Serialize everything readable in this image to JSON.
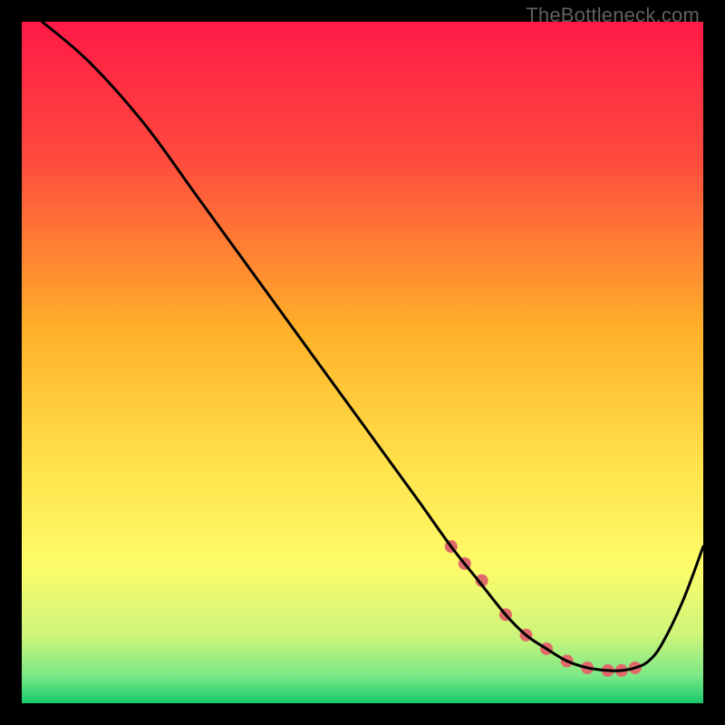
{
  "watermark": "TheBottleneck.com",
  "chart_data": {
    "type": "line",
    "title": "",
    "xlabel": "",
    "ylabel": "",
    "xlim": [
      0,
      100
    ],
    "ylim": [
      0,
      100
    ],
    "grid": false,
    "legend": false,
    "gradient_stops": [
      {
        "offset": 0.0,
        "color": "#ff1a47"
      },
      {
        "offset": 0.2,
        "color": "#ff4a3e"
      },
      {
        "offset": 0.45,
        "color": "#ffb029"
      },
      {
        "offset": 0.65,
        "color": "#ffe24a"
      },
      {
        "offset": 0.8,
        "color": "#fdfc6a"
      },
      {
        "offset": 0.9,
        "color": "#cdf57a"
      },
      {
        "offset": 0.96,
        "color": "#7be886"
      },
      {
        "offset": 1.0,
        "color": "#17c96b"
      }
    ],
    "series": [
      {
        "name": "bottleneck-curve",
        "color": "#000000",
        "x": [
          3,
          10,
          18,
          26,
          34,
          42,
          50,
          58,
          63,
          67,
          71,
          74,
          77,
          80,
          83,
          86,
          88,
          90,
          92,
          94,
          97,
          100
        ],
        "values": [
          100,
          94,
          85,
          74,
          63,
          52,
          41,
          30,
          23,
          18,
          13,
          10,
          8,
          6.2,
          5.2,
          4.8,
          4.8,
          5.2,
          6.2,
          8.8,
          15,
          23
        ]
      }
    ],
    "markers": {
      "name": "highlight-dots",
      "color": "#e06a6a",
      "radius": 7,
      "x": [
        63,
        65,
        67.5,
        71,
        74,
        77,
        80,
        83,
        86,
        88,
        90
      ],
      "values": [
        23,
        20.5,
        18,
        13,
        10,
        8,
        6.2,
        5.2,
        4.8,
        4.8,
        5.2
      ]
    }
  }
}
